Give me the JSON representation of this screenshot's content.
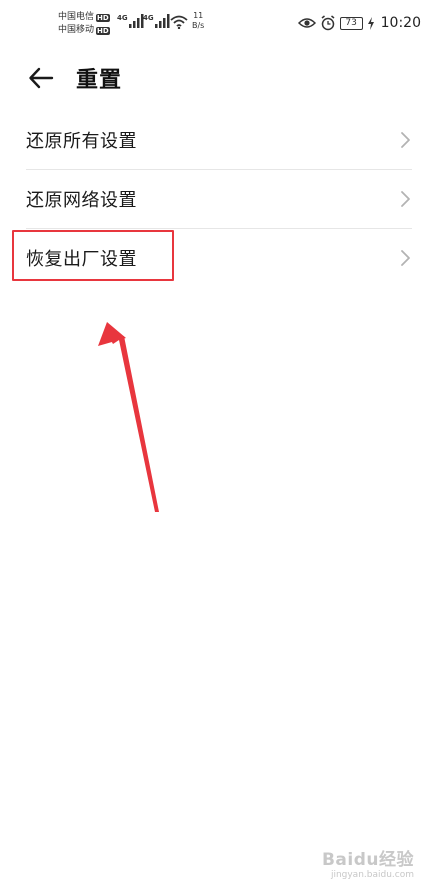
{
  "status_bar": {
    "carrier_1": "中国电信",
    "carrier_2": "中国移动",
    "hd_badge": "HD",
    "network_type": "4G",
    "net_speed_value": "11",
    "net_speed_unit": "B/s",
    "battery_level": "73",
    "time": "10:20"
  },
  "header": {
    "title": "重置"
  },
  "settings_list": {
    "items": [
      {
        "label": "还原所有设置"
      },
      {
        "label": "还原网络设置"
      },
      {
        "label": "恢复出厂设置"
      }
    ]
  },
  "annotation": {
    "highlight_color": "#e8363e"
  },
  "watermark": {
    "brand": "Baidu经验",
    "url": "jingyan.baidu.com"
  },
  "colors": {
    "text_primary": "#1a1a1a",
    "divider": "#e6e6e6",
    "chevron": "#b3b3b3"
  }
}
